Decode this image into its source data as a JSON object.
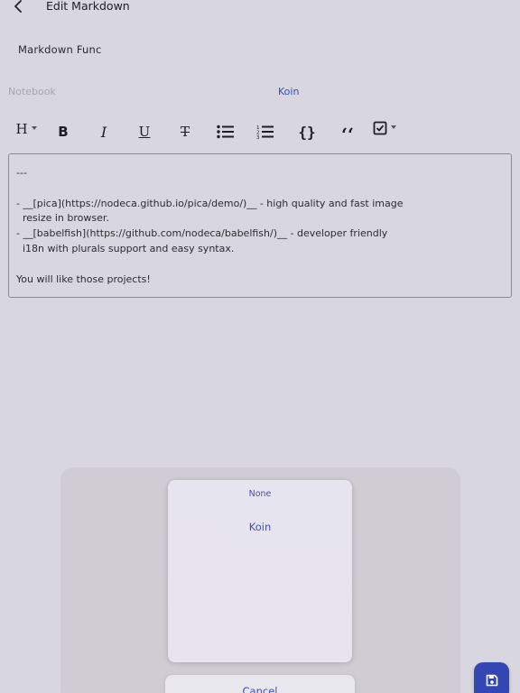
{
  "app_bar": {
    "title": "Edit Markdown"
  },
  "note": {
    "title": "Markdown Func",
    "notebook_label": "Notebook",
    "notebook_value": "Koin"
  },
  "toolbar": {
    "heading": "H",
    "bold": "B",
    "italic": "I",
    "underline": "U",
    "strikethrough": "T",
    "code": "{}",
    "quote": "‘‘"
  },
  "editor": {
    "lines": [
      "---",
      "",
      "- __[pica](https://nodeca.github.io/pica/demo/)__ - high quality and fast image",
      "  resize in browser.",
      "- __[babelfish](https://github.com/nodeca/babelfish/)__ - developer friendly",
      "  i18n with plurals support and easy syntax.",
      "",
      "You will like those projects!"
    ]
  },
  "picker": {
    "options": [
      "None",
      "Koin"
    ],
    "cancel_label": "Cancel"
  },
  "colors": {
    "accent": "#3446b4",
    "link": "#3b4bb7",
    "background": "#d8d6de"
  },
  "icons": {
    "back": "chevron-left-icon",
    "bullets": "bulleted-list-icon",
    "numbers": "numbered-list-icon",
    "checkbox": "checkbox-icon",
    "save": "floppy-disk-icon"
  }
}
